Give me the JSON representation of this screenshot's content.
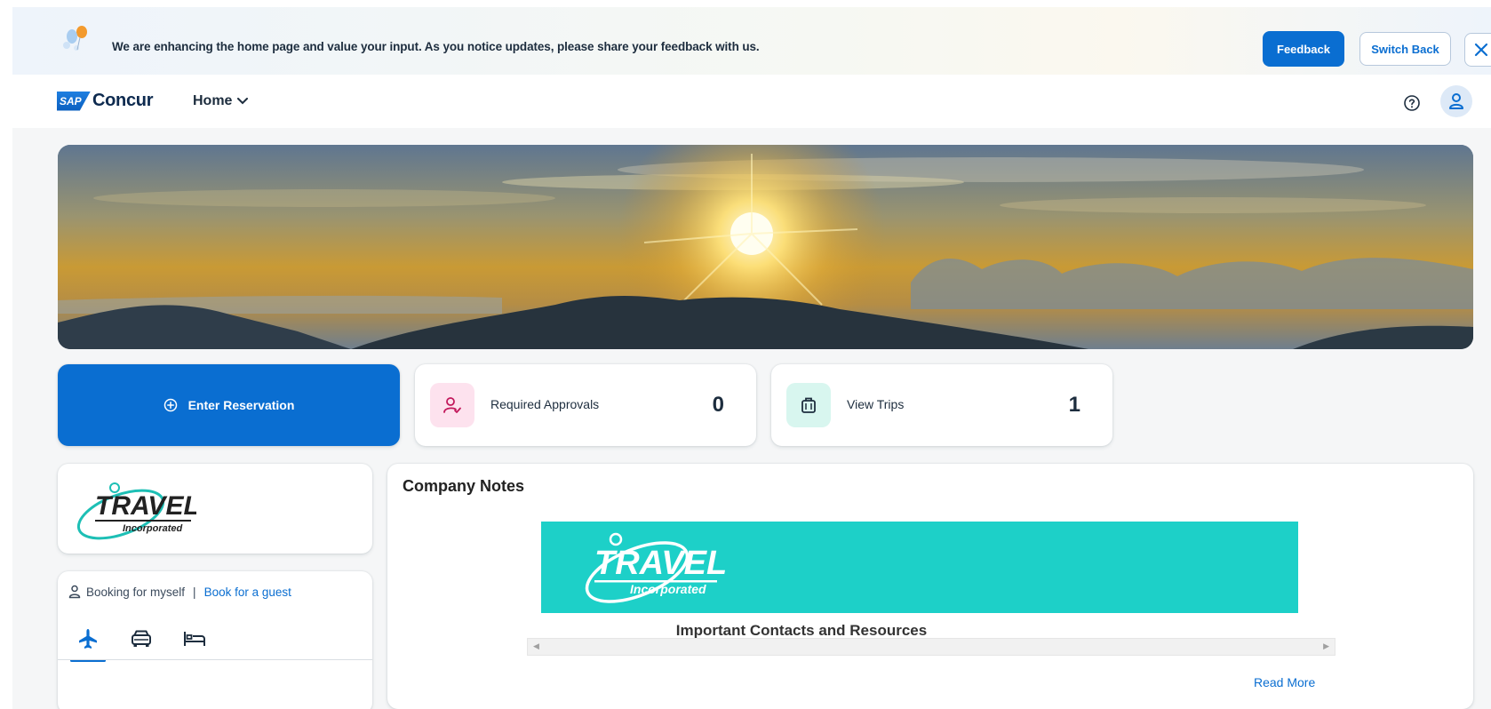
{
  "banner": {
    "message": "We are enhancing the home page and value your input. As you notice updates, please share your feedback with us.",
    "feedback_label": "Feedback",
    "switch_back_label": "Switch Back",
    "close_icon": "close-icon"
  },
  "header": {
    "logo_sap": "SAP",
    "logo_product": "Concur",
    "home_menu": "Home",
    "help_icon": "help-icon",
    "profile_icon": "user-icon"
  },
  "tiles": {
    "enter_reservation": "Enter Reservation",
    "required_approvals": {
      "label": "Required Approvals",
      "count": "0"
    },
    "view_trips": {
      "label": "View Trips",
      "count": "1"
    }
  },
  "company_logo": {
    "brand": "TRAVEL",
    "tagline": "Incorporated"
  },
  "booking": {
    "myself": "Booking for myself",
    "separator": "|",
    "guest": "Book for a guest",
    "modes": [
      "flight",
      "car",
      "hotel"
    ],
    "active_mode": "flight"
  },
  "company_notes": {
    "title": "Company Notes",
    "banner_brand": "TRAVEL",
    "banner_tagline": "Incorporated",
    "heading": "Important Contacts and Resources",
    "read_more": "Read More"
  },
  "colors": {
    "primary": "#0a6ed1",
    "approvals_icon_bg": "#fde2ee",
    "trips_icon_bg": "#d8f6ef",
    "notes_banner": "#1dd0c8"
  }
}
